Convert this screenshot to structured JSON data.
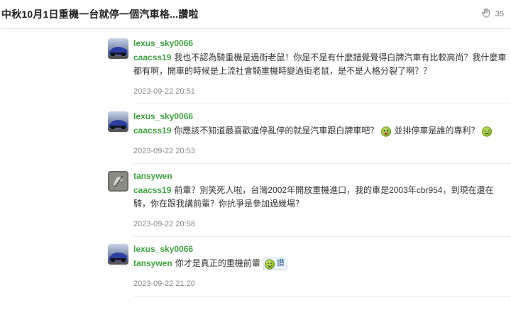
{
  "header": {
    "title": "中秋10月1日重機一台就停一個汽車格...讚啦",
    "clap_count": "35"
  },
  "comments": [
    {
      "author": "lexus_sky0066",
      "mention": "caacss19",
      "text": "我也不認為騎重機是過街老鼠！你是不是有什麼錯覺覺得白牌汽車有比較高尚？我什麼車都有啊，開車的時候是上流社會騎重機時變過街老鼠，是不是人格分裂了啊？？",
      "time": "2023-09-22 20:51"
    },
    {
      "author": "lexus_sky0066",
      "mention": "caacss19",
      "text_part1": "你應該不知道最喜歡違停亂停的就是汽車跟白牌車吧？",
      "text_part2": "並排停車是誰的專利？",
      "time": "2023-09-22 20:53"
    },
    {
      "author": "tansywen",
      "mention": "caacss19",
      "text": "前輩？別笑死人啦，台灣2002年開放重機進口，我的車是2003年cbr954，到現在還在騎，你在跟我講前輩？你抗爭是參加過幾場？",
      "time": "2023-09-22 20:58"
    },
    {
      "author": "lexus_sky0066",
      "mention": "tansywen",
      "text": "你才是真正的重機前輩",
      "sticker_label": "讚",
      "time": "2023-09-22 21:20"
    }
  ]
}
